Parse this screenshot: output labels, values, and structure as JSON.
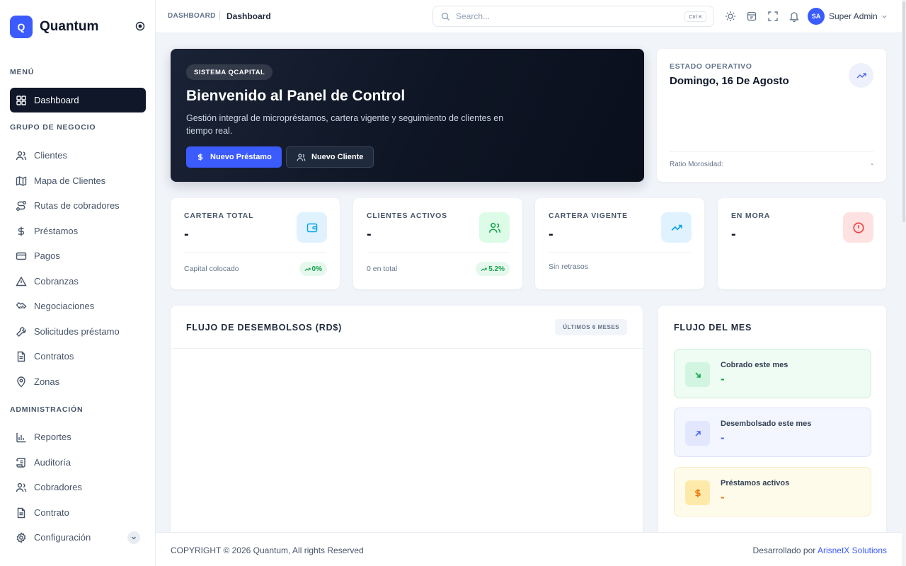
{
  "brand": {
    "logo_letter": "Q",
    "name": "Quantum"
  },
  "sidebar": {
    "sections": [
      {
        "label": "MENÚ",
        "items": [
          {
            "label": "Dashboard",
            "icon": "grid-icon",
            "active": true
          }
        ]
      },
      {
        "label": "GRUPO DE NEGOCIO",
        "items": [
          {
            "label": "Clientes",
            "icon": "users-icon"
          },
          {
            "label": "Mapa de Clientes",
            "icon": "map-icon"
          },
          {
            "label": "Rutas de cobradores",
            "icon": "route-icon"
          },
          {
            "label": "Préstamos",
            "icon": "dollar-icon"
          },
          {
            "label": "Pagos",
            "icon": "credit-card-icon"
          },
          {
            "label": "Cobranzas",
            "icon": "alert-triangle-icon"
          },
          {
            "label": "Negociaciones",
            "icon": "handshake-icon"
          },
          {
            "label": "Solicitudes préstamo",
            "icon": "wrench-icon"
          },
          {
            "label": "Contratos",
            "icon": "file-icon"
          },
          {
            "label": "Zonas",
            "icon": "map-pin-icon"
          }
        ]
      },
      {
        "label": "ADMINISTRACIÓN",
        "items": [
          {
            "label": "Reportes",
            "icon": "bar-chart-icon"
          },
          {
            "label": "Auditoría",
            "icon": "scroll-icon"
          },
          {
            "label": "Cobradores",
            "icon": "users-icon"
          },
          {
            "label": "Contrato",
            "icon": "file-icon"
          },
          {
            "label": "Configuración",
            "icon": "gear-icon",
            "expandable": true
          }
        ]
      }
    ]
  },
  "topbar": {
    "breadcrumb_root": "DASHBOARD",
    "breadcrumb_current": "Dashboard",
    "search_placeholder": "Search...",
    "search_shortcut": "Ctrl K",
    "user_initials": "SA",
    "user_name": "Super Admin"
  },
  "hero": {
    "badge": "SISTEMA QCAPITAL",
    "title": "Bienvenido al Panel de Control",
    "description": "Gestión integral de micropréstamos, cartera vigente y seguimiento de clientes en tiempo real.",
    "primary_button": "Nuevo Préstamo",
    "secondary_button": "Nuevo Cliente"
  },
  "estado": {
    "label": "ESTADO OPERATIVO",
    "date": "Domingo, 16 De Agosto",
    "ratio_label": "Ratio Morosidad:",
    "ratio_value": "-"
  },
  "stats": [
    {
      "label": "CARTERA TOTAL",
      "value": "-",
      "footer": "Capital colocado",
      "pill": "0%",
      "icon": "wallet-icon",
      "icon_bg": "#e0f2fe",
      "icon_color": "#0ea5e9"
    },
    {
      "label": "CLIENTES ACTIVOS",
      "value": "-",
      "footer": "0 en total",
      "pill": "5.2%",
      "icon": "users-icon",
      "icon_bg": "#dcfce7",
      "icon_color": "#16a34a"
    },
    {
      "label": "CARTERA VIGENTE",
      "value": "-",
      "footer": "Sin retrasos",
      "pill": "",
      "icon": "trend-up-icon",
      "icon_bg": "#e0f2fe",
      "icon_color": "#0ea5e9"
    },
    {
      "label": "EN MORA",
      "value": "-",
      "footer": "",
      "pill": "",
      "icon": "alert-circle-icon",
      "icon_bg": "#fee2e2",
      "icon_color": "#ef4444"
    }
  ],
  "flujo": {
    "title": "FLUJO DE DESEMBOLSOS (RD$)",
    "badge": "ÚLTIMOS 6 MESES"
  },
  "mes": {
    "title": "FLUJO DEL MES",
    "items": [
      {
        "label": "Cobrado este mes",
        "value": "-",
        "icon": "arrow-down-right-icon",
        "bg": "#eefcf3",
        "border": "#cdeedb",
        "icon_bg": "#d1f5e0",
        "color": "#16a34a"
      },
      {
        "label": "Desembolsado este mes",
        "value": "-",
        "icon": "arrow-up-right-icon",
        "bg": "#f3f5ff",
        "border": "#dfe4fb",
        "icon_bg": "#e2e7fd",
        "color": "#4f6bf6"
      },
      {
        "label": "Préstamos activos",
        "value": "-",
        "icon": "dollar-icon",
        "bg": "#fffbeb",
        "border": "#f8ecc5",
        "icon_bg": "#fde9a9",
        "color": "#ea7b0c"
      }
    ]
  },
  "footer": {
    "copyright": "COPYRIGHT © 2026 Quantum, All rights Reserved",
    "dev_prefix": "Desarrollado por ",
    "dev_link": "ArisnetX Solutions"
  }
}
